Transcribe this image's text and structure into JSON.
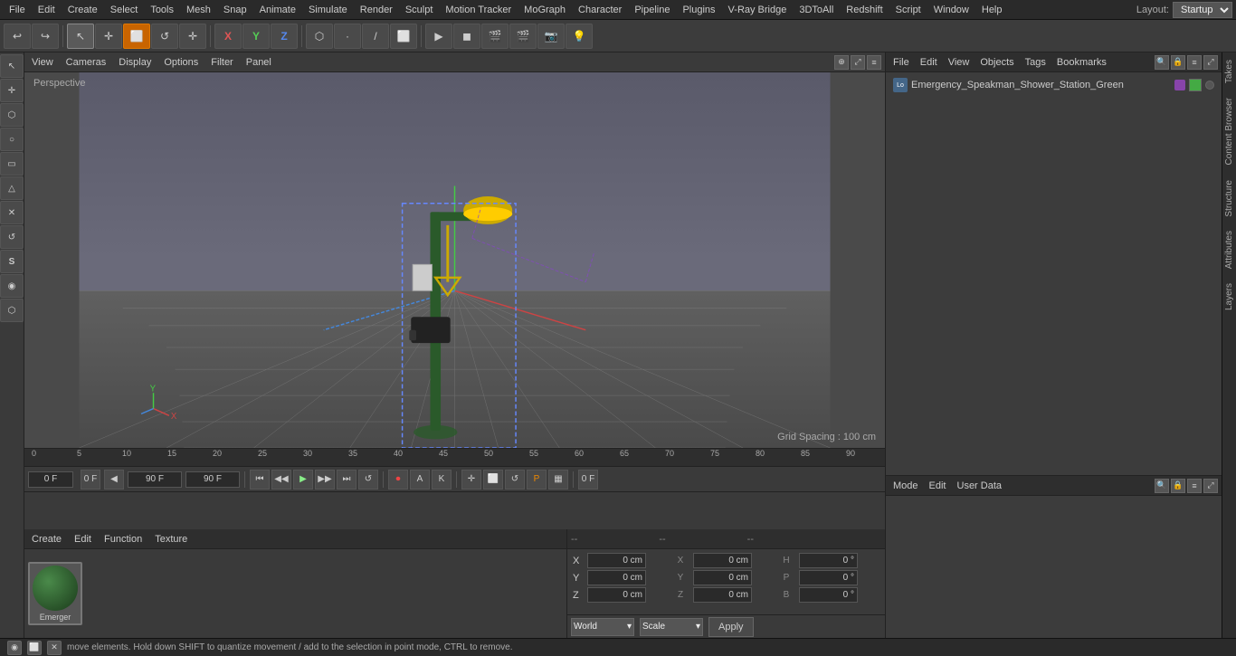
{
  "app": {
    "title": "Cinema 4D"
  },
  "menu": {
    "items": [
      "File",
      "Edit",
      "Create",
      "Select",
      "Tools",
      "Mesh",
      "Snap",
      "Animate",
      "Simulate",
      "Render",
      "Sculpt",
      "Motion Tracker",
      "MoGraph",
      "Character",
      "Pipeline",
      "Plugins",
      "V-Ray Bridge",
      "3DToAll",
      "Redshift",
      "Script",
      "Window",
      "Help"
    ],
    "layout_label": "Layout:",
    "layout_value": "Startup"
  },
  "toolbar": {
    "undo_label": "↩",
    "transform_mode_labels": [
      "↖",
      "✛",
      "⬛",
      "↺",
      "✛"
    ],
    "axis_labels": [
      "X",
      "Y",
      "Z"
    ],
    "shape_labels": [
      "⬡",
      "⬡",
      "⬡",
      "⬡"
    ],
    "view_labels": [
      "▶",
      "◼",
      "🎬",
      "🎬",
      "📷",
      "💡"
    ]
  },
  "viewport": {
    "tabs": [
      "View",
      "Cameras",
      "Display",
      "Options",
      "Filter",
      "Panel"
    ],
    "perspective_label": "Perspective",
    "grid_spacing": "Grid Spacing : 100 cm"
  },
  "timeline": {
    "ticks": [
      "0",
      "5",
      "10",
      "15",
      "20",
      "25",
      "30",
      "35",
      "40",
      "45",
      "50",
      "55",
      "60",
      "65",
      "70",
      "75",
      "80",
      "85",
      "90"
    ],
    "current_frame": "0 F",
    "start_frame": "0 F",
    "end_frame": "90 F",
    "preview_end": "90 F",
    "frame_field": "0 F"
  },
  "transport": {
    "buttons": [
      "⏮",
      "◀◀",
      "▶",
      "▶▶",
      "⏭",
      "↺"
    ],
    "record_btn": "⏺",
    "auto_btn": "A",
    "key_btn": "K",
    "motion_btn": "M",
    "playback_btns": [
      "▦",
      "▦",
      "P",
      "▦",
      "▦"
    ]
  },
  "material_panel": {
    "tabs": [
      "Create",
      "Edit",
      "Function",
      "Texture"
    ],
    "items": [
      {
        "name": "Emerger",
        "color": "#2a6a2a"
      }
    ]
  },
  "coordinates": {
    "header": [
      "--",
      "--",
      "--"
    ],
    "rows": [
      {
        "label": "X",
        "pos": "0 cm",
        "label2": "X",
        "size": "0 cm",
        "label3": "H",
        "rot": "0 °"
      },
      {
        "label": "Y",
        "pos": "0 cm",
        "label2": "Y",
        "size": "0 cm",
        "label3": "P",
        "rot": "0 °"
      },
      {
        "label": "Z",
        "pos": "0 cm",
        "label2": "Z",
        "size": "0 cm",
        "label3": "B",
        "rot": "0 °"
      }
    ],
    "world_label": "World",
    "scale_label": "Scale",
    "apply_label": "Apply"
  },
  "object_manager": {
    "header_items": [
      "File",
      "Edit",
      "View",
      "Objects",
      "Tags",
      "Bookmarks"
    ],
    "objects": [
      {
        "name": "Emergency_Speakman_Shower_Station_Green",
        "icon": "Lo",
        "color": "#8844aa"
      }
    ]
  },
  "attribute_manager": {
    "header_items": [
      "Mode",
      "Edit",
      "User Data"
    ]
  },
  "edge_tabs": [
    "Takes",
    "Content Browser",
    "Structure",
    "Attributes",
    "Layers"
  ],
  "status_bar": {
    "text": "move elements. Hold down SHIFT to quantize movement / add to the selection in point mode, CTRL to remove."
  },
  "sidebar_tools": [
    "▷",
    "⊕",
    "⬡",
    "◯",
    "⬜",
    "▲",
    "⊗",
    "⟳",
    "S",
    "⊙",
    "⬡"
  ]
}
